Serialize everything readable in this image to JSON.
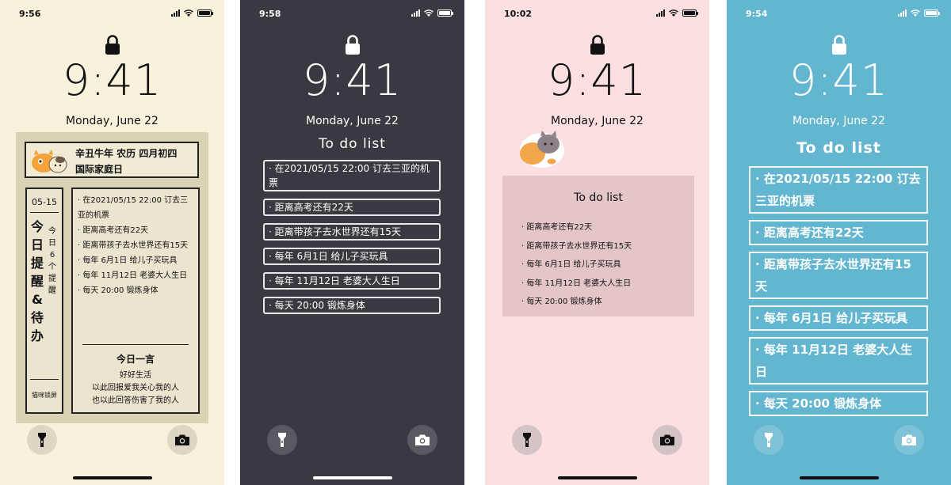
{
  "common": {
    "lock_time": "9:41",
    "date": "Monday, June 22"
  },
  "phones": [
    {
      "status_time": "9:56",
      "header_line1": "辛丑牛年 农历 四月初四",
      "header_line2": "国际家庭日",
      "left_date": "05-15",
      "left_vertical_big": "今日提醒&待办",
      "left_vertical_small": "今日6个提醒",
      "left_footer": "猫咪锁屏",
      "todos": [
        "· 在2021/05/15 22:00 订去三亚的机票",
        "· 距离高考还有22天",
        "· 距离带孩子去水世界还有15天",
        "· 每年 6月1日 给儿子买玩具",
        "· 每年 11月12日 老婆大人生日",
        "· 每天 20:00 锻炼身体"
      ],
      "quote_title": "今日一言",
      "quote_lines": [
        "好好生活",
        "以此回报爱我关心我的人",
        "也以此回答伤害了我的人"
      ]
    },
    {
      "status_time": "9:58",
      "title": "To do list",
      "todos": [
        "· 在2021/05/15 22:00 订去三亚的机票",
        "· 距离高考还有22天",
        "· 距离带孩子去水世界还有15天",
        "· 每年 6月1日 给儿子买玩具",
        "· 每年 11月12日 老婆大人生日",
        "· 每天 20:00 锻炼身体"
      ]
    },
    {
      "status_time": "10:02",
      "title": "To do list",
      "todos": [
        "· 距离高考还有22天",
        "· 距离带孩子去水世界还有15天",
        "· 每年 6月1日 给儿子买玩具",
        "· 每年 11月12日 老婆大人生日",
        "· 每天 20:00 锻炼身体"
      ]
    },
    {
      "status_time": "9:54",
      "title": "To do list",
      "todos": [
        "· 在2021/05/15 22:00 订去三亚的机票",
        "· 距离高考还有22天",
        "· 距离带孩子去水世界还有15天",
        "· 每年 6月1日 给儿子买玩具",
        "· 每年 11月12日 老婆大人生日",
        "· 每天 20:00 锻炼身体"
      ]
    }
  ],
  "icons": {
    "lock": "lock-icon",
    "flashlight": "flashlight-icon",
    "camera": "camera-icon"
  }
}
